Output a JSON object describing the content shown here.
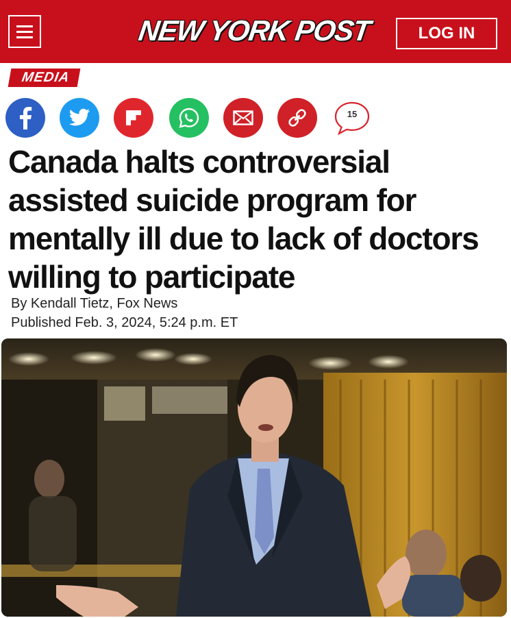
{
  "header": {
    "menu_icon": "hamburger-menu-icon",
    "logo_text": "NEW YORK POST",
    "login_label": "LOG IN",
    "brand_color": "#c8101c"
  },
  "article": {
    "section": "MEDIA",
    "share_icons": [
      "facebook-icon",
      "twitter-icon",
      "flipboard-icon",
      "whatsapp-icon",
      "email-icon",
      "copy-link-icon",
      "comment-icon"
    ],
    "comment_count": "15",
    "headline": "Canada halts controversial assisted suicide program for mentally ill due to lack of doctors willing to participate",
    "byline": "By Kendall Tietz, Fox News",
    "published": "Published Feb. 3, 2024, 5:24 p.m. ET"
  }
}
